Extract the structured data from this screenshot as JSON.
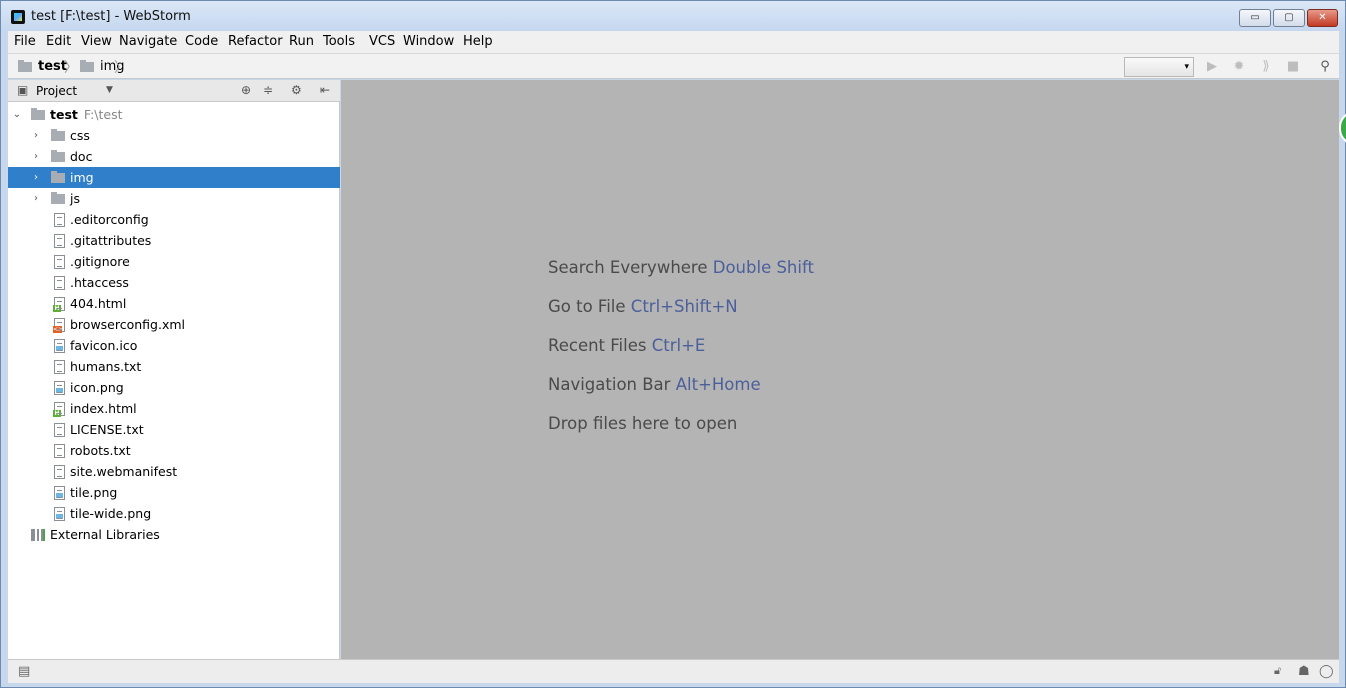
{
  "window": {
    "title": "test [F:\\test] - WebStorm",
    "controls": {
      "minimize": "▭",
      "maximize": "▢",
      "close": "✕"
    }
  },
  "menu": [
    "File",
    "Edit",
    "View",
    "Navigate",
    "Code",
    "Refactor",
    "Run",
    "Tools",
    "VCS",
    "Window",
    "Help"
  ],
  "breadcrumb": {
    "root": "test",
    "current": "img"
  },
  "toolbar": {
    "icons": [
      "run-icon",
      "debug-icon",
      "coverage-icon",
      "stop-icon",
      "search-icon"
    ]
  },
  "project": {
    "header": "Project",
    "root": {
      "name": "test",
      "path": "F:\\test"
    },
    "folders": [
      "css",
      "doc",
      "img",
      "js"
    ],
    "selected": "img",
    "files": [
      {
        "name": ".editorconfig",
        "type": "text"
      },
      {
        "name": ".gitattributes",
        "type": "text"
      },
      {
        "name": ".gitignore",
        "type": "text"
      },
      {
        "name": ".htaccess",
        "type": "text"
      },
      {
        "name": "404.html",
        "type": "html"
      },
      {
        "name": "browserconfig.xml",
        "type": "xml"
      },
      {
        "name": "favicon.ico",
        "type": "image"
      },
      {
        "name": "humans.txt",
        "type": "text"
      },
      {
        "name": "icon.png",
        "type": "image"
      },
      {
        "name": "index.html",
        "type": "html"
      },
      {
        "name": "LICENSE.txt",
        "type": "text"
      },
      {
        "name": "robots.txt",
        "type": "text"
      },
      {
        "name": "site.webmanifest",
        "type": "text"
      },
      {
        "name": "tile.png",
        "type": "image"
      },
      {
        "name": "tile-wide.png",
        "type": "image"
      }
    ],
    "external": "External Libraries"
  },
  "editor": {
    "hints": [
      {
        "text": "Search Everywhere",
        "shortcut": "Double Shift"
      },
      {
        "text": "Go to File",
        "shortcut": "Ctrl+Shift+N"
      },
      {
        "text": "Recent Files",
        "shortcut": "Ctrl+E"
      },
      {
        "text": "Navigation Bar",
        "shortcut": "Alt+Home"
      },
      {
        "text": "Drop files here to open",
        "shortcut": ""
      }
    ]
  }
}
